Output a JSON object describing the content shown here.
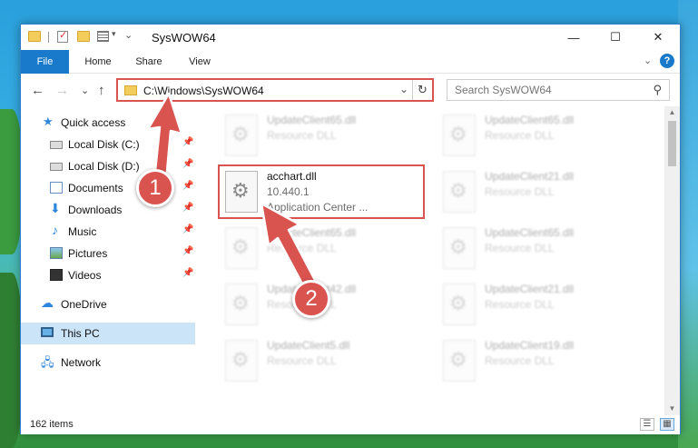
{
  "window": {
    "title": "SysWOW64",
    "minimize_glyph": "—",
    "maximize_glyph": "☐",
    "close_glyph": "✕"
  },
  "ribbon": {
    "tabs": [
      "File",
      "Home",
      "Share",
      "View"
    ],
    "expand_glyph": "⌄",
    "help_glyph": "?"
  },
  "nav": {
    "back_glyph": "←",
    "forward_glyph": "→",
    "recent_glyph": "⌄",
    "up_glyph": "↑",
    "address": "C:\\Windows\\SysWOW64",
    "address_dropdown_glyph": "⌄",
    "refresh_glyph": "↻",
    "search_placeholder": "Search SysWOW64",
    "search_icon_glyph": "⚲"
  },
  "sidebar": {
    "quick_access": "Quick access",
    "pin_glyph": "📌",
    "items": [
      {
        "label": "Local Disk (C:)"
      },
      {
        "label": "Local Disk (D:)"
      },
      {
        "label": "Documents"
      },
      {
        "label": "Downloads"
      },
      {
        "label": "Music"
      },
      {
        "label": "Pictures"
      },
      {
        "label": "Videos"
      }
    ],
    "onedrive": "OneDrive",
    "this_pc": "This PC",
    "network": "Network"
  },
  "files": {
    "gear_glyph": "⚙",
    "left_column": [
      {
        "name": "UpdateClient65.dll",
        "type": "Resource DLL"
      },
      {
        "name": "acchart.dll",
        "version": "10.440.1",
        "description": "Application Center ..."
      },
      {
        "name": "UpdateClient65.dll",
        "type": "Resource DLL"
      },
      {
        "name": "UpdateClient42.dll",
        "type": "Resource DLL"
      },
      {
        "name": "UpdateClient5.dll",
        "type": "Resource DLL"
      }
    ],
    "right_column": [
      {
        "name": "UpdateClient65.dll",
        "type": "Resource DLL"
      },
      {
        "name": "UpdateClient21.dll",
        "type": "Resource DLL"
      },
      {
        "name": "UpdateClient65.dll",
        "type": "Resource DLL"
      },
      {
        "name": "UpdateClient21.dll",
        "type": "Resource DLL"
      },
      {
        "name": "UpdateClient19.dll",
        "type": "Resource DLL"
      }
    ]
  },
  "scrollbar": {
    "up_glyph": "▲",
    "down_glyph": "▼"
  },
  "status": {
    "item_count": "162 items",
    "details_view_glyph": "☰",
    "tiles_view_glyph": "▦"
  },
  "annotations": {
    "step1": "1",
    "step2": "2",
    "color": "#d9534f"
  }
}
